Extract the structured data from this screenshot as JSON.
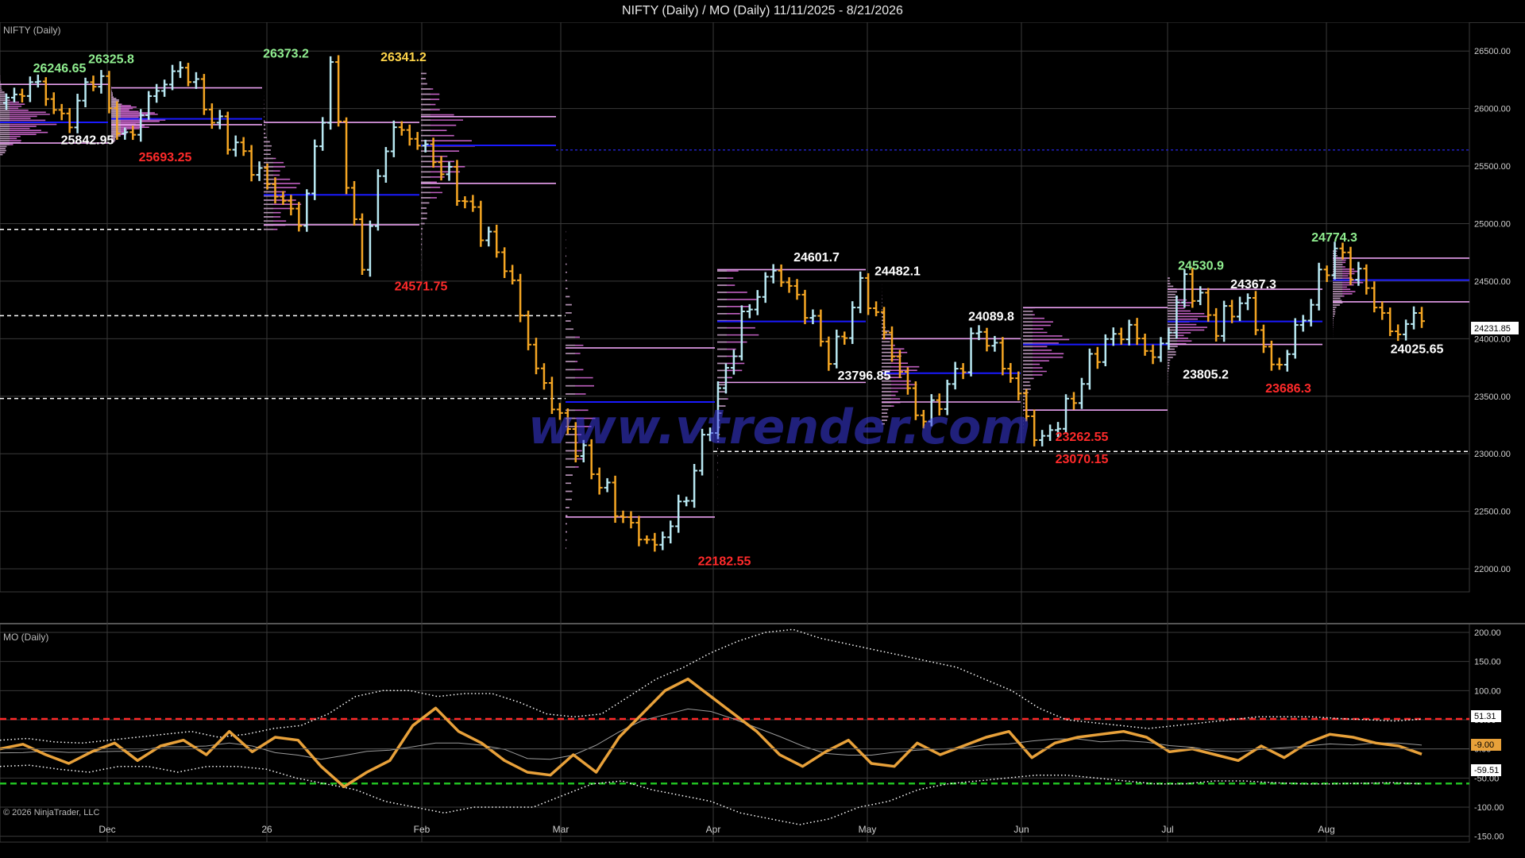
{
  "window": {
    "title": "NIFTY (Daily) / MO (Daily)  11/11/2025 - 8/21/2026"
  },
  "panels": {
    "price_label": "NIFTY (Daily)",
    "indicator_label": "MO (Daily)",
    "copyright": "© 2026 NinjaTrader, LLC",
    "watermark": "www.vtrender.com"
  },
  "colors": {
    "background": "#000000",
    "up_bar": "#b8e8f2",
    "down_bar": "#f5a623",
    "profile": "#e070e0",
    "profile_initial": "#aaaaaa",
    "poc": "#1a1aff",
    "value_area": "#e9a0f0",
    "ref_dashed": "#ffffff",
    "mo_line": "#e8a13a",
    "mo_upper": "#ff2a2a",
    "mo_lower": "#22c022",
    "annotation_high": "#90ee90",
    "annotation_yellow": "#ffd54a",
    "annotation_white": "#ffffff",
    "annotation_low": "#ff2a2a"
  },
  "chart_data": [
    {
      "type": "candlestick",
      "series_name": "NIFTY (Daily)",
      "ylim": [
        21800,
        26750
      ],
      "y_ticks": [
        22000,
        22500,
        23000,
        23500,
        24000,
        24500,
        25000,
        25500,
        26000,
        26500
      ],
      "x_labels": [
        "Dec",
        "26",
        "Feb",
        "Mar",
        "Apr",
        "May",
        "Jun",
        "Jul",
        "Aug"
      ],
      "x_range": [
        "11/11/2025",
        "8/21/2026"
      ],
      "last_price": "24231.85",
      "ohlc_path": [
        26050,
        26246.65,
        25842.95,
        26325.8,
        25693.25,
        26150,
        26373.2,
        25900,
        25600,
        25300,
        25000,
        26341.2,
        24571.75,
        25850,
        25700,
        25400,
        25000,
        24600,
        23700,
        23200,
        22800,
        22400,
        22182.55,
        22600,
        23400,
        24200,
        24601.7,
        24300,
        23796.85,
        24482.1,
        23900,
        23262.55,
        23600,
        24089.8,
        23700,
        23070.15,
        23400,
        23900,
        24100,
        23805.2,
        24530.9,
        24100,
        24367.3,
        23686.3,
        24200,
        24774.3,
        24500,
        24025.65,
        24231.85
      ],
      "annotations": [
        {
          "text": "26246.65",
          "price": 26246.65,
          "kind": "high"
        },
        {
          "text": "26325.8",
          "price": 26325.8,
          "kind": "high"
        },
        {
          "text": "25842.95",
          "price": 25842.95,
          "kind": "white"
        },
        {
          "text": "25693.25",
          "price": 25693.25,
          "kind": "low"
        },
        {
          "text": "26373.2",
          "price": 26373.2,
          "kind": "high"
        },
        {
          "text": "26341.2",
          "price": 26341.2,
          "kind": "yellow"
        },
        {
          "text": "24571.75",
          "price": 24571.75,
          "kind": "low"
        },
        {
          "text": "24601.7",
          "price": 24601.7,
          "kind": "white"
        },
        {
          "text": "24482.1",
          "price": 24482.1,
          "kind": "white"
        },
        {
          "text": "23796.85",
          "price": 23796.85,
          "kind": "white"
        },
        {
          "text": "24089.8",
          "price": 24089.8,
          "kind": "white"
        },
        {
          "text": "23262.55",
          "price": 23262.55,
          "kind": "low"
        },
        {
          "text": "23070.15",
          "price": 23070.15,
          "kind": "low"
        },
        {
          "text": "22182.55",
          "price": 22182.55,
          "kind": "low"
        },
        {
          "text": "24530.9",
          "price": 24530.9,
          "kind": "high"
        },
        {
          "text": "24367.3",
          "price": 24367.3,
          "kind": "white"
        },
        {
          "text": "23805.2",
          "price": 23805.2,
          "kind": "white"
        },
        {
          "text": "23686.3",
          "price": 23686.3,
          "kind": "low"
        },
        {
          "text": "24774.3",
          "price": 24774.3,
          "kind": "high"
        },
        {
          "text": "24025.65",
          "price": 24025.65,
          "kind": "white"
        }
      ],
      "reference_levels": [
        24950,
        24200,
        23480,
        23020,
        25640
      ]
    },
    {
      "type": "line",
      "series_name": "MO (Daily)",
      "ylim": [
        -160,
        215
      ],
      "y_ticks": [
        200,
        150,
        100,
        50,
        0,
        -50,
        -100,
        -150
      ],
      "upper_level": "51.31",
      "current_value": "-9.00",
      "lower_level": "-59.51",
      "mo_values": [
        0,
        8,
        -10,
        -25,
        -5,
        10,
        -20,
        5,
        15,
        -10,
        30,
        -5,
        20,
        15,
        -30,
        -65,
        -40,
        -20,
        40,
        70,
        30,
        10,
        -20,
        -40,
        -45,
        -10,
        -40,
        20,
        60,
        100,
        120,
        90,
        60,
        30,
        -10,
        -30,
        -5,
        15,
        -25,
        -30,
        10,
        -10,
        5,
        20,
        30,
        -15,
        10,
        20,
        25,
        30,
        20,
        -5,
        0,
        -10,
        -20,
        5,
        -15,
        10,
        25,
        20,
        10,
        5,
        -9
      ],
      "upper_band": [
        15,
        18,
        12,
        10,
        15,
        20,
        25,
        30,
        20,
        25,
        35,
        40,
        60,
        90,
        100,
        100,
        90,
        95,
        95,
        80,
        60,
        55,
        60,
        90,
        120,
        140,
        165,
        185,
        200,
        205,
        190,
        180,
        170,
        160,
        150,
        140,
        120,
        100,
        70,
        50,
        45,
        40,
        35,
        40,
        45,
        50,
        55,
        55,
        55,
        52,
        50,
        48,
        51
      ],
      "lower_band": [
        -30,
        -28,
        -35,
        -40,
        -30,
        -30,
        -40,
        -30,
        -30,
        -35,
        -50,
        -60,
        -70,
        -90,
        -100,
        -110,
        -100,
        -100,
        -100,
        -80,
        -60,
        -55,
        -70,
        -80,
        -90,
        -110,
        -120,
        -130,
        -120,
        -100,
        -90,
        -70,
        -60,
        -55,
        -50,
        -45,
        -45,
        -50,
        -55,
        -60,
        -60,
        -55,
        -55,
        -58,
        -60,
        -60,
        -59,
        -58,
        -60
      ]
    }
  ]
}
